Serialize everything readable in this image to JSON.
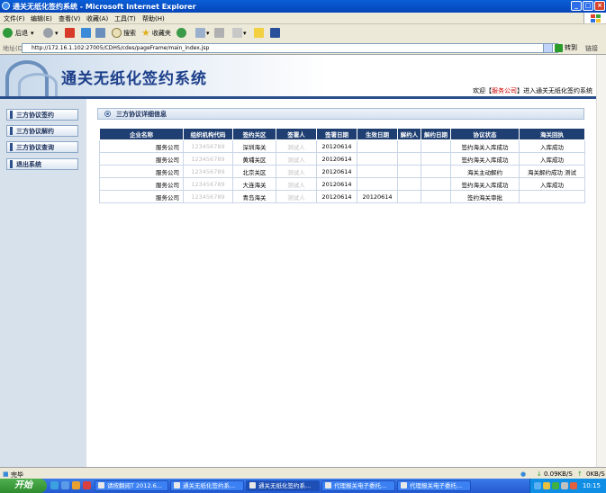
{
  "window": {
    "title": "通关无纸化签约系统 - Microsoft Internet Explorer"
  },
  "menu": [
    "文件(F)",
    "编辑(E)",
    "查看(V)",
    "收藏(A)",
    "工具(T)",
    "帮助(H)"
  ],
  "toolbar": {
    "back": "后退",
    "search": "搜索",
    "favorites": "收藏夹"
  },
  "address": {
    "label": "地址(D)",
    "url": "http://172.16.1.102:27005/CDHS/cdes/pageFrame/main_index.jsp",
    "go": "转到",
    "links": "链接"
  },
  "banner": {
    "title": "通关无纸化签约系统",
    "welcome_prefix": "欢迎【",
    "user": "服务公司",
    "welcome_suffix": "】进入通关无纸化签约系统"
  },
  "sidebar": {
    "items": [
      {
        "label": "三方协议签约"
      },
      {
        "label": "三方协议解约"
      },
      {
        "label": "三方协议查询"
      },
      {
        "label": "退出系统"
      }
    ]
  },
  "section": {
    "title": "三方协议详细信息"
  },
  "table": {
    "headers": [
      "企业名称",
      "组织机构代码",
      "签约关区",
      "签署人",
      "签署日期",
      "生效日期",
      "解约人",
      "解约日期",
      "协议状态",
      "海关回执"
    ],
    "rows": [
      [
        "服务公司",
        "123456789",
        "深圳海关",
        "测试人",
        "20120614",
        "",
        "",
        "",
        "签约海关入库成功",
        "入库成功"
      ],
      [
        "服务公司",
        "123456789",
        "黄埔关区",
        "测试人",
        "20120614",
        "",
        "",
        "",
        "签约海关入库成功",
        "入库成功"
      ],
      [
        "服务公司",
        "123456789",
        "北京关区",
        "测试人",
        "20120614",
        "",
        "",
        "",
        "海关主动解约",
        "海关解约成功 测试"
      ],
      [
        "服务公司",
        "123456789",
        "大连海关",
        "测试人",
        "20120614",
        "",
        "",
        "",
        "签约海关入库成功",
        "入库成功"
      ],
      [
        "服务公司",
        "123456789",
        "青岛海关",
        "测试人",
        "20120614",
        "20120614",
        "",
        "",
        "签约海关审批",
        ""
      ]
    ]
  },
  "status": {
    "text": "完毕",
    "speed": "0.09KB/S",
    "speed2": "0KB/S"
  },
  "taskbar": {
    "start": "开始",
    "tasks": [
      "请按翻阅T 2012.6...",
      "通关无纸化签约系...",
      "通关无纸化签约系...",
      "代理报关电子委托...",
      "代理报关电子委托..."
    ],
    "clock": "10:15"
  },
  "colors": {
    "header_bg": "#1f3f72",
    "title_blue": "#1c3f8a",
    "taskbar": "#245ad0",
    "start_green": "#2e8b2e"
  }
}
